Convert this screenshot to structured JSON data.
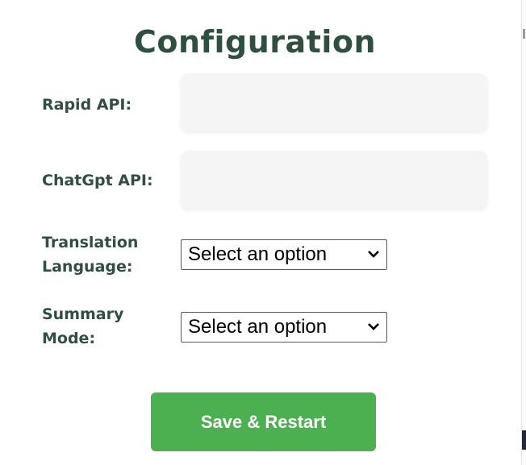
{
  "title": "Configuration",
  "fields": {
    "rapid_api": {
      "label": "Rapid API:",
      "value": ""
    },
    "chatgpt_api": {
      "label": "ChatGpt API:",
      "value": ""
    },
    "translation_language": {
      "label_line1": "Translation",
      "label_line2": "Language:",
      "selected": "Select an option"
    },
    "summary_mode": {
      "label_line1": "Summary",
      "label_line2": "Mode:",
      "selected": "Select an option"
    }
  },
  "save_button": {
    "label": "Save & Restart"
  },
  "colors": {
    "heading": "#2f4f3f",
    "button": "#4caf50",
    "input_bg": "#f5f5f5"
  }
}
